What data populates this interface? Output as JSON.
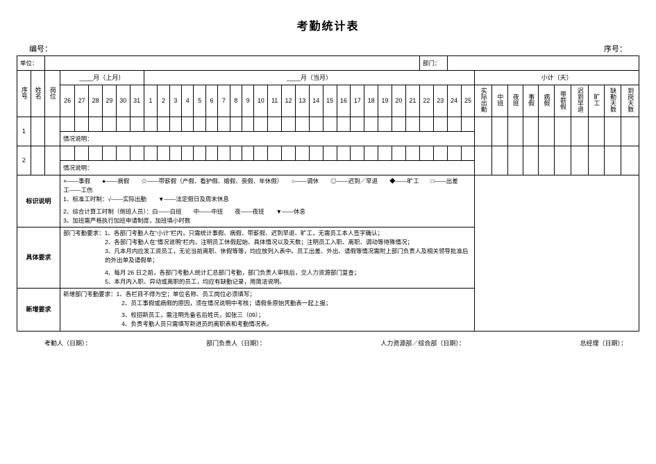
{
  "title": "考勤统计表",
  "header": {
    "serial_label": "编号：",
    "order_label": "序号："
  },
  "row1": {
    "unit_label": "单位：",
    "dept_label": "部门："
  },
  "row2": {
    "prev_month_label": "____月（上月）",
    "this_month_label": "____月（当月）",
    "subtotal_label": "小计（天）"
  },
  "cols": {
    "seq": "序号",
    "name": "姓名",
    "post": "岗位",
    "days_prev": [
      "26",
      "27",
      "28",
      "29",
      "30",
      "31"
    ],
    "days_curr": [
      "1",
      "2",
      "3",
      "4",
      "5",
      "6",
      "7",
      "8",
      "9",
      "10",
      "11",
      "12",
      "13",
      "14",
      "15",
      "16",
      "17",
      "18",
      "19",
      "20",
      "21",
      "22",
      "23",
      "24",
      "25"
    ],
    "sub": [
      "实际出勤",
      "中班",
      "夜班",
      "事假",
      "病假",
      "带薪假",
      "迟到早退",
      "旷工",
      "缺勤天数",
      "到岗天数"
    ]
  },
  "rows": {
    "ids": [
      "1",
      "2"
    ],
    "situation_label": "情况说明："
  },
  "legend": {
    "label": "标识说明",
    "line0": "×——事假　　●——病假　　☆——带薪假（产假、看护假、婚假、丧假、年休假）　　○——调休　　◎——迟到／早退　　◆——旷工　　□——出差　　工——工伤",
    "line1": "1、标准工时制：√——实际出勤　　▼——法定假日及周末休息",
    "line2": "2、综合计算工时制（倒班人员）：白——白班　　中——中班　　夜——夜班　　▼——休息",
    "line3": "3、加班需严格执行加班申请制度，加班填小时数"
  },
  "req": {
    "label": "具体要求",
    "lead": "部门考勤要求：",
    "l1": "1、各部门考勤人在“小计”栏内，只需统计事假、病假、带薪假、迟到早退、旷工，无需员工本人签字确认；",
    "l2": "2、各部门考勤人在“情况说明”栏内，注明员工休假起始、具体情况以及天数；注明员工入职、离职、调动等待殊情况；",
    "l3": "3、凡本月内应发工资员工，无论当前离职、休假等等，均应放列入表中。员工出差、外出、请假等情况需附上部门负责人及相关领导批准后的外出单及请假单；",
    "l4": "4、每月 26 日之前，各部门考勤人统计汇总部门考勤，部门负责人审核后，交人力资源部门复查；",
    "l5": "5、本月内入职、异动或离职的员工，均应有缺勤记录，用简洁说明。"
  },
  "add": {
    "label": "新增要求",
    "lead": "新增部门考勤要求：",
    "l1": "1、各栏目不得为空；单位名称、员工岗位必须填写；",
    "l2": "2、员工事假或病假的原因，须在情况说明中考核；请假条原始凭勤表一起上报；",
    "l3": "3、校招新员工，需注明先备名后姓氏，如张三（09）；",
    "l4": "4、负责考勤人员只需填写新进员的离职表和考勤情况表。"
  },
  "footer": {
    "a": "考勤人（日期）：",
    "b": "部门负责人（日期）：",
    "c": "人力资源部／综合部（日期）：",
    "d": "总经理（日期）："
  }
}
